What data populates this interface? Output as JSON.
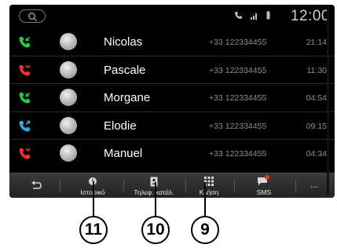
{
  "status": {
    "clock": "12:00"
  },
  "calls": [
    {
      "name": "Nicolas",
      "number": "+33 122334455",
      "time": "21:14",
      "type": "incoming",
      "color": "#27c93f"
    },
    {
      "name": "Pascale",
      "number": "+33 122334455",
      "time": "11:30",
      "type": "missed",
      "color": "#e8352c"
    },
    {
      "name": "Morgane",
      "number": "+33 122334455",
      "time": "04:54",
      "type": "incoming",
      "color": "#27c93f"
    },
    {
      "name": "Elodie",
      "number": "+33 122334455",
      "time": "09:15",
      "type": "outgoing",
      "color": "#2fa4e7"
    },
    {
      "name": "Manuel",
      "number": "+33 122334455",
      "time": "04:34",
      "type": "missed",
      "color": "#e8352c"
    }
  ],
  "nav": {
    "back_icon": "back-arrow-icon",
    "history_label": "Ιστορικό",
    "contacts_label": "Τηλεφ. κατάλ.",
    "dial_label": "Κλήση",
    "sms_label": "SMS",
    "more_label": "..."
  },
  "callouts": [
    "11",
    "10",
    "9"
  ]
}
